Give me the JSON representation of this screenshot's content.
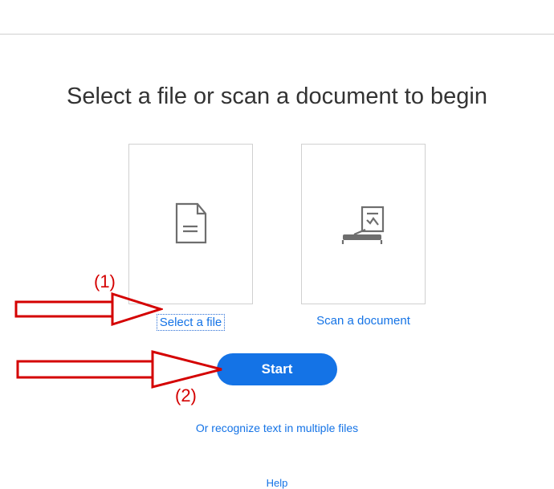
{
  "title": "Select a file or scan a document to begin",
  "cards": {
    "select_file": {
      "label": "Select a file",
      "icon": "file-icon",
      "selected": true
    },
    "scan_document": {
      "label": "Scan a document",
      "icon": "scanner-icon",
      "selected": false
    }
  },
  "start_label": "Start",
  "recognize_link": "Or recognize text in multiple files",
  "help_link": "Help",
  "annotations": {
    "arrow1_label": "(1)",
    "arrow2_label": "(2)"
  },
  "colors": {
    "link_blue": "#1473e6",
    "button_blue": "#1473e6",
    "annotation_red": "#d40000",
    "icon_gray": "#6e6e6e"
  }
}
